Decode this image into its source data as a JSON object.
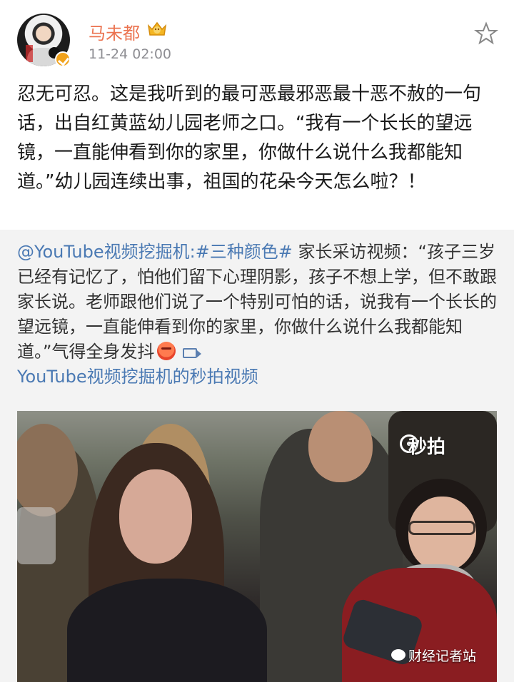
{
  "header": {
    "username": "马未都",
    "time": "11-24 02:00"
  },
  "post": {
    "text": "忍无可忍。这是我听到的最可恶最邪恶最十恶不赦的一句话，出自红黄蓝幼儿园老师之口。“我有一个长长的望远镜，一直能伸看到你的家里，你做什么说什么我都能知道。”幼儿园连续出事，祖国的花朵今天怎么啦？！"
  },
  "retweet": {
    "source_user": "@YouTube视频挖掘机",
    "hashtag": ":#三种颜色#",
    "text": "家长采访视频：“孩子三岁已经有记忆了，怕他们留下心理阴影，孩子不想上学，但不敢跟家长说。老师跟他们说了一个特别可怕的话，说我有一个长长的望远镜，一直能伸看到你的家里，你做什么说什么我都能知道。”气得全身发抖",
    "video_link": "YouTube视频挖掘机的秒拍视频"
  },
  "video": {
    "badge": "秒拍"
  },
  "footer": {
    "watermark": "财经记者站"
  },
  "colors": {
    "username": "#eb7350",
    "link": "#4a79b3",
    "text": "#1a1a1a",
    "meta": "#8e8e93",
    "retweet_bg": "#f3f3f3"
  }
}
